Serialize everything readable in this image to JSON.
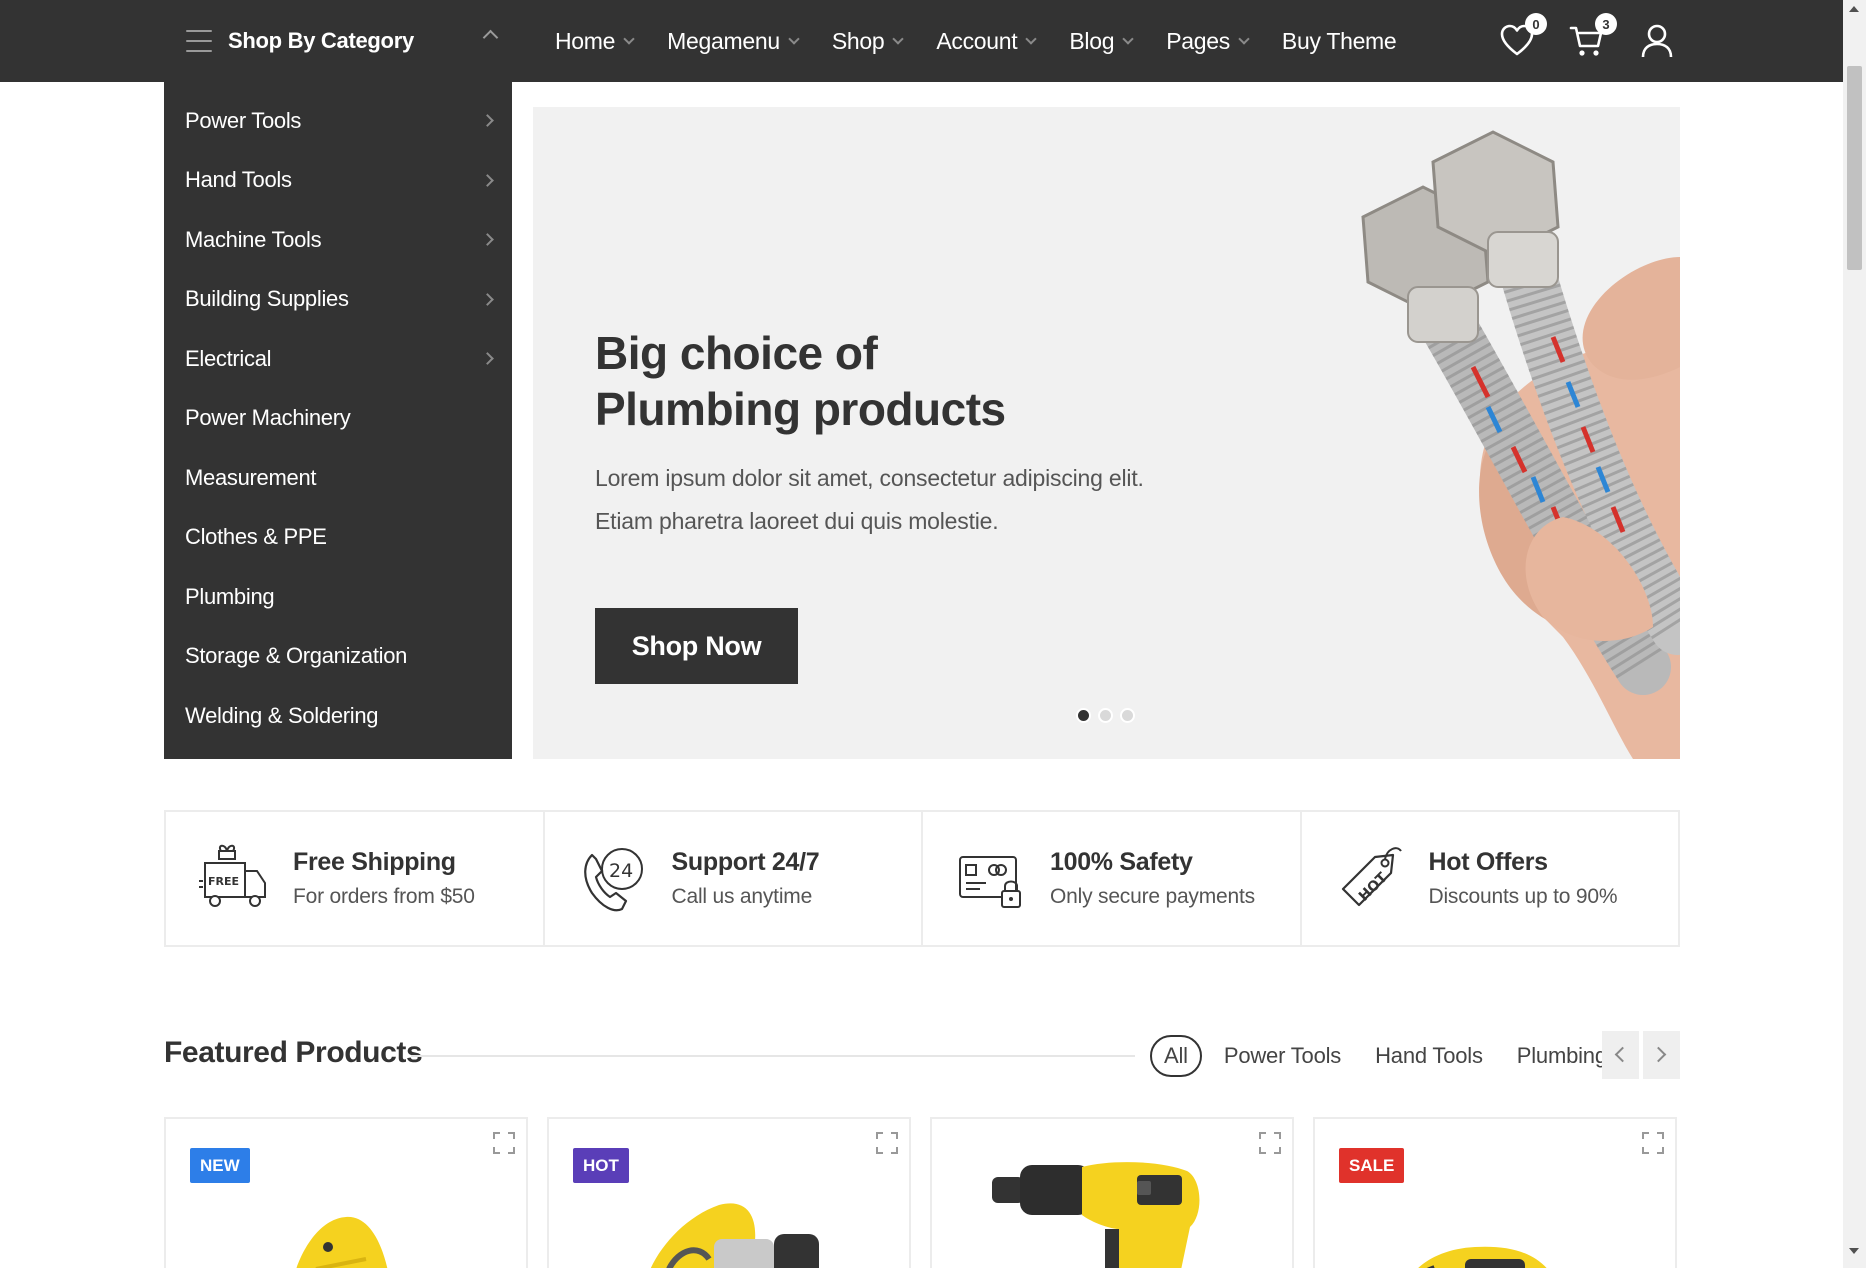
{
  "header": {
    "category_button": "Shop By Category",
    "nav": [
      "Home",
      "Megamenu",
      "Shop",
      "Account",
      "Blog",
      "Pages",
      "Buy Theme"
    ],
    "wishlist_count": "0",
    "cart_count": "3"
  },
  "sidebar": {
    "items": [
      {
        "label": "Power Tools",
        "has_submenu": true
      },
      {
        "label": "Hand Tools",
        "has_submenu": true
      },
      {
        "label": "Machine Tools",
        "has_submenu": true
      },
      {
        "label": "Building Supplies",
        "has_submenu": true
      },
      {
        "label": "Electrical",
        "has_submenu": true
      },
      {
        "label": "Power Machinery",
        "has_submenu": false
      },
      {
        "label": "Measurement",
        "has_submenu": false
      },
      {
        "label": "Clothes & PPE",
        "has_submenu": false
      },
      {
        "label": "Plumbing",
        "has_submenu": false
      },
      {
        "label": "Storage & Organization",
        "has_submenu": false
      },
      {
        "label": "Welding & Soldering",
        "has_submenu": false
      }
    ]
  },
  "hero": {
    "title_line1": "Big choice of",
    "title_line2": "Plumbing products",
    "desc_line1": "Lorem ipsum dolor sit amet, consectetur adipiscing elit.",
    "desc_line2": "Etiam pharetra laoreet dui quis molestie.",
    "button": "Shop Now",
    "slide_count": 3,
    "active_slide": 1
  },
  "features": [
    {
      "icon": "free-shipping-truck-icon",
      "title": "Free Shipping",
      "subtitle": "For orders from $50"
    },
    {
      "icon": "support-24-phone-icon",
      "title": "Support 24/7",
      "subtitle": "Call us anytime"
    },
    {
      "icon": "secure-card-lock-icon",
      "title": "100% Safety",
      "subtitle": "Only secure payments"
    },
    {
      "icon": "hot-tag-icon",
      "title": "Hot Offers",
      "subtitle": "Discounts up to 90%"
    }
  ],
  "featured": {
    "title": "Featured Products",
    "tabs": [
      "All",
      "Power Tools",
      "Hand Tools",
      "Plumbing"
    ],
    "active_tab": "All",
    "products": [
      {
        "badge": "NEW",
        "badge_color": "#2d7ee8"
      },
      {
        "badge": "HOT",
        "badge_color": "#5a3eb8"
      },
      {
        "badge": "",
        "badge_color": ""
      },
      {
        "badge": "SALE",
        "badge_color": "#e0322b"
      }
    ]
  },
  "colors": {
    "dark": "#333333",
    "hero_bg": "#f1f1f1",
    "product_yellow": "#f5d21f"
  }
}
